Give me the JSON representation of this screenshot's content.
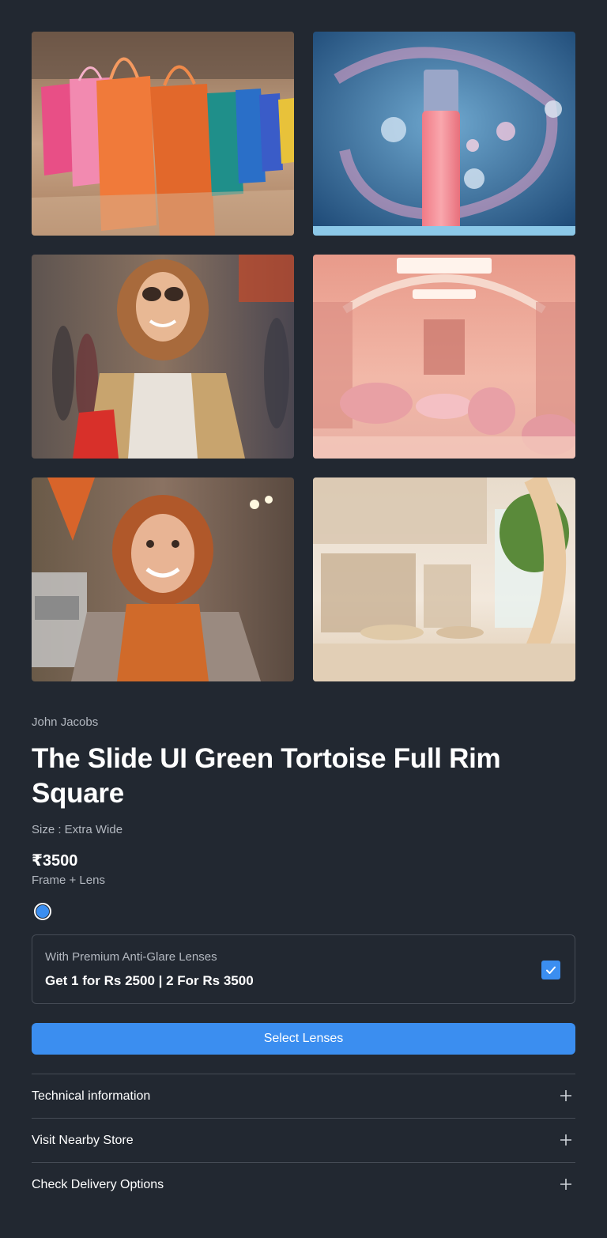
{
  "gallery": [
    {
      "name": "shopping-bags-image",
      "alt": "Colorful shopping bags"
    },
    {
      "name": "serum-bottle-image",
      "alt": "Pink serum bottle"
    },
    {
      "name": "woman-sunglasses-image",
      "alt": "Woman with sunglasses shopping"
    },
    {
      "name": "pink-store-interior-image",
      "alt": "Pink store interior"
    },
    {
      "name": "smiling-cashier-image",
      "alt": "Smiling cashier"
    },
    {
      "name": "bright-store-interior-image",
      "alt": "Bright store interior"
    }
  ],
  "product": {
    "brand": "John Jacobs",
    "title": "The Slide UI Green Tortoise Full Rim Square",
    "size": "Size : Extra Wide",
    "price": "₹3500",
    "price_sub": "Frame + Lens",
    "swatch_color": "#3b8ef0"
  },
  "offer": {
    "line1": "With Premium Anti-Glare Lenses",
    "line2": "Get 1 for Rs 2500 | 2 For Rs 3500",
    "checked": true
  },
  "cta": {
    "label": "Select Lenses"
  },
  "accordion": [
    {
      "label": "Technical information",
      "icon": "plus-icon"
    },
    {
      "label": "Visit Nearby Store",
      "icon": "plus-icon"
    },
    {
      "label": "Check Delivery Options",
      "icon": "plus-icon"
    }
  ],
  "colors": {
    "background": "#222831",
    "accent": "#3b8ef0",
    "divider": "#454b55",
    "muted": "#b3b8c0"
  }
}
